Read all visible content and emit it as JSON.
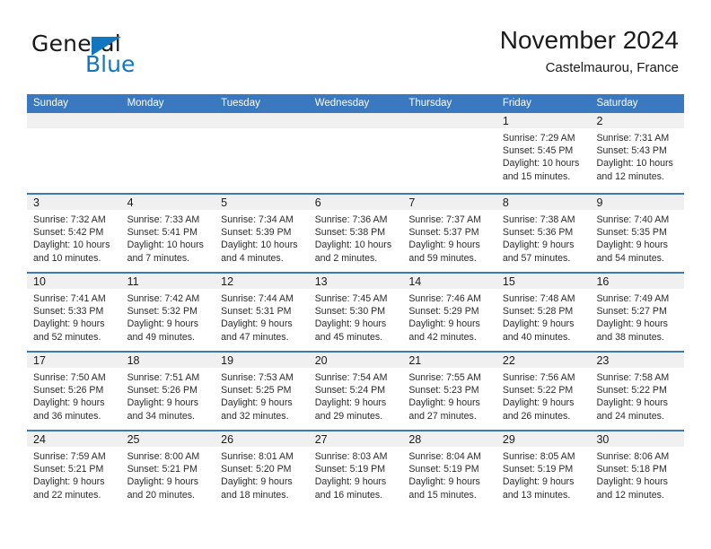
{
  "brand": {
    "name_part1": "General",
    "name_part2": "Blue",
    "triangle_color": "#1277bf"
  },
  "header": {
    "title": "November 2024",
    "location": "Castelmaurou, France"
  },
  "theme": {
    "header_blue": "#3a78bf",
    "band_gray": "#f0f0f0",
    "text": "#1b1b1b"
  },
  "weekdays": [
    "Sunday",
    "Monday",
    "Tuesday",
    "Wednesday",
    "Thursday",
    "Friday",
    "Saturday"
  ],
  "weeks": [
    [
      {
        "day": "",
        "sunrise": "",
        "sunset": "",
        "daylight": ""
      },
      {
        "day": "",
        "sunrise": "",
        "sunset": "",
        "daylight": ""
      },
      {
        "day": "",
        "sunrise": "",
        "sunset": "",
        "daylight": ""
      },
      {
        "day": "",
        "sunrise": "",
        "sunset": "",
        "daylight": ""
      },
      {
        "day": "",
        "sunrise": "",
        "sunset": "",
        "daylight": ""
      },
      {
        "day": "1",
        "sunrise": "Sunrise: 7:29 AM",
        "sunset": "Sunset: 5:45 PM",
        "daylight": "Daylight: 10 hours and 15 minutes."
      },
      {
        "day": "2",
        "sunrise": "Sunrise: 7:31 AM",
        "sunset": "Sunset: 5:43 PM",
        "daylight": "Daylight: 10 hours and 12 minutes."
      }
    ],
    [
      {
        "day": "3",
        "sunrise": "Sunrise: 7:32 AM",
        "sunset": "Sunset: 5:42 PM",
        "daylight": "Daylight: 10 hours and 10 minutes."
      },
      {
        "day": "4",
        "sunrise": "Sunrise: 7:33 AM",
        "sunset": "Sunset: 5:41 PM",
        "daylight": "Daylight: 10 hours and 7 minutes."
      },
      {
        "day": "5",
        "sunrise": "Sunrise: 7:34 AM",
        "sunset": "Sunset: 5:39 PM",
        "daylight": "Daylight: 10 hours and 4 minutes."
      },
      {
        "day": "6",
        "sunrise": "Sunrise: 7:36 AM",
        "sunset": "Sunset: 5:38 PM",
        "daylight": "Daylight: 10 hours and 2 minutes."
      },
      {
        "day": "7",
        "sunrise": "Sunrise: 7:37 AM",
        "sunset": "Sunset: 5:37 PM",
        "daylight": "Daylight: 9 hours and 59 minutes."
      },
      {
        "day": "8",
        "sunrise": "Sunrise: 7:38 AM",
        "sunset": "Sunset: 5:36 PM",
        "daylight": "Daylight: 9 hours and 57 minutes."
      },
      {
        "day": "9",
        "sunrise": "Sunrise: 7:40 AM",
        "sunset": "Sunset: 5:35 PM",
        "daylight": "Daylight: 9 hours and 54 minutes."
      }
    ],
    [
      {
        "day": "10",
        "sunrise": "Sunrise: 7:41 AM",
        "sunset": "Sunset: 5:33 PM",
        "daylight": "Daylight: 9 hours and 52 minutes."
      },
      {
        "day": "11",
        "sunrise": "Sunrise: 7:42 AM",
        "sunset": "Sunset: 5:32 PM",
        "daylight": "Daylight: 9 hours and 49 minutes."
      },
      {
        "day": "12",
        "sunrise": "Sunrise: 7:44 AM",
        "sunset": "Sunset: 5:31 PM",
        "daylight": "Daylight: 9 hours and 47 minutes."
      },
      {
        "day": "13",
        "sunrise": "Sunrise: 7:45 AM",
        "sunset": "Sunset: 5:30 PM",
        "daylight": "Daylight: 9 hours and 45 minutes."
      },
      {
        "day": "14",
        "sunrise": "Sunrise: 7:46 AM",
        "sunset": "Sunset: 5:29 PM",
        "daylight": "Daylight: 9 hours and 42 minutes."
      },
      {
        "day": "15",
        "sunrise": "Sunrise: 7:48 AM",
        "sunset": "Sunset: 5:28 PM",
        "daylight": "Daylight: 9 hours and 40 minutes."
      },
      {
        "day": "16",
        "sunrise": "Sunrise: 7:49 AM",
        "sunset": "Sunset: 5:27 PM",
        "daylight": "Daylight: 9 hours and 38 minutes."
      }
    ],
    [
      {
        "day": "17",
        "sunrise": "Sunrise: 7:50 AM",
        "sunset": "Sunset: 5:26 PM",
        "daylight": "Daylight: 9 hours and 36 minutes."
      },
      {
        "day": "18",
        "sunrise": "Sunrise: 7:51 AM",
        "sunset": "Sunset: 5:26 PM",
        "daylight": "Daylight: 9 hours and 34 minutes."
      },
      {
        "day": "19",
        "sunrise": "Sunrise: 7:53 AM",
        "sunset": "Sunset: 5:25 PM",
        "daylight": "Daylight: 9 hours and 32 minutes."
      },
      {
        "day": "20",
        "sunrise": "Sunrise: 7:54 AM",
        "sunset": "Sunset: 5:24 PM",
        "daylight": "Daylight: 9 hours and 29 minutes."
      },
      {
        "day": "21",
        "sunrise": "Sunrise: 7:55 AM",
        "sunset": "Sunset: 5:23 PM",
        "daylight": "Daylight: 9 hours and 27 minutes."
      },
      {
        "day": "22",
        "sunrise": "Sunrise: 7:56 AM",
        "sunset": "Sunset: 5:22 PM",
        "daylight": "Daylight: 9 hours and 26 minutes."
      },
      {
        "day": "23",
        "sunrise": "Sunrise: 7:58 AM",
        "sunset": "Sunset: 5:22 PM",
        "daylight": "Daylight: 9 hours and 24 minutes."
      }
    ],
    [
      {
        "day": "24",
        "sunrise": "Sunrise: 7:59 AM",
        "sunset": "Sunset: 5:21 PM",
        "daylight": "Daylight: 9 hours and 22 minutes."
      },
      {
        "day": "25",
        "sunrise": "Sunrise: 8:00 AM",
        "sunset": "Sunset: 5:21 PM",
        "daylight": "Daylight: 9 hours and 20 minutes."
      },
      {
        "day": "26",
        "sunrise": "Sunrise: 8:01 AM",
        "sunset": "Sunset: 5:20 PM",
        "daylight": "Daylight: 9 hours and 18 minutes."
      },
      {
        "day": "27",
        "sunrise": "Sunrise: 8:03 AM",
        "sunset": "Sunset: 5:19 PM",
        "daylight": "Daylight: 9 hours and 16 minutes."
      },
      {
        "day": "28",
        "sunrise": "Sunrise: 8:04 AM",
        "sunset": "Sunset: 5:19 PM",
        "daylight": "Daylight: 9 hours and 15 minutes."
      },
      {
        "day": "29",
        "sunrise": "Sunrise: 8:05 AM",
        "sunset": "Sunset: 5:19 PM",
        "daylight": "Daylight: 9 hours and 13 minutes."
      },
      {
        "day": "30",
        "sunrise": "Sunrise: 8:06 AM",
        "sunset": "Sunset: 5:18 PM",
        "daylight": "Daylight: 9 hours and 12 minutes."
      }
    ]
  ]
}
